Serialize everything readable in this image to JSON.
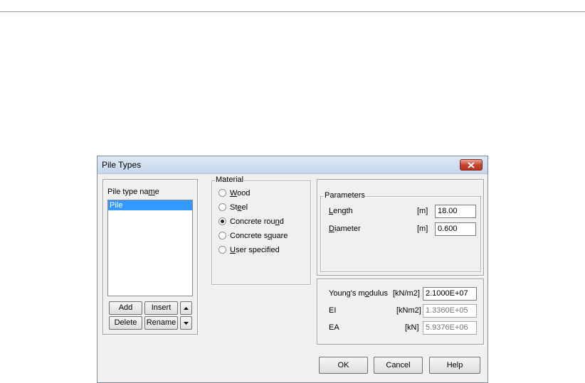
{
  "window": {
    "title": "Pile Types"
  },
  "pile_list": {
    "label_pre": "Pile type na",
    "label_mn": "m",
    "label_post": "e",
    "items": [
      "Pile"
    ],
    "selected": "Pile"
  },
  "list_buttons": {
    "add": "Add",
    "insert": "Insert",
    "delete": "Delete",
    "rename": "Rename",
    "up_icon": "arrow-up",
    "down_icon": "arrow-down"
  },
  "material": {
    "legend": "Material",
    "options": [
      {
        "pre": "",
        "mn": "W",
        "post": "ood",
        "checked": false
      },
      {
        "pre": "St",
        "mn": "e",
        "post": "el",
        "checked": false
      },
      {
        "pre": "Concrete rou",
        "mn": "n",
        "post": "d",
        "checked": true
      },
      {
        "pre": "Concrete s",
        "mn": "q",
        "post": "uare",
        "checked": false
      },
      {
        "pre": "",
        "mn": "U",
        "post": "ser specified",
        "checked": false
      }
    ]
  },
  "parameters": {
    "legend": "Parameters",
    "length": {
      "mn": "L",
      "post": "ength",
      "unit": "[m]",
      "value": "18.00"
    },
    "diameter": {
      "mn": "D",
      "post": "iameter",
      "unit": "[m]",
      "value": "0.600"
    }
  },
  "properties": {
    "youngs": {
      "pre": "Young's m",
      "mn": "o",
      "post": "dulus",
      "unit": "[kN/m2]",
      "value": "2.1000E+07"
    },
    "ei": {
      "label": "EI",
      "unit": "[kNm2]",
      "value": "1.3360E+05"
    },
    "ea": {
      "label": "EA",
      "unit": "[kN]",
      "value": "5.9376E+06"
    }
  },
  "buttons": {
    "ok": "OK",
    "cancel": "Cancel",
    "help": "Help"
  },
  "colors": {
    "selection": "#3399ff",
    "close_button": "#c8452f",
    "titlebar": "#c5d6ec"
  }
}
